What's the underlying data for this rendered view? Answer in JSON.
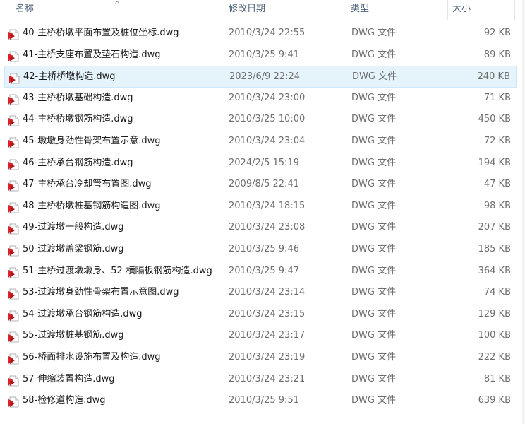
{
  "columns": {
    "name": "名称",
    "date": "修改日期",
    "type": "类型",
    "size": "大小"
  },
  "sort_indicator": "^",
  "icon": "dwg-file-icon",
  "colors": {
    "selected_bg": "#e5f3fb",
    "selected_border": "#cce8ff",
    "icon_red": "#d8232a"
  },
  "selected_index": 2,
  "files": [
    {
      "name": "40-主桥桥墩平面布置及桩位坐标.dwg",
      "date": "2010/3/24 22:55",
      "type": "DWG 文件",
      "size": "92 KB"
    },
    {
      "name": "41-主桥支座布置及垫石构造.dwg",
      "date": "2010/3/25 9:41",
      "type": "DWG 文件",
      "size": "89 KB"
    },
    {
      "name": "42-主桥桥墩构造.dwg",
      "date": "2023/6/9 22:24",
      "type": "DWG 文件",
      "size": "240 KB"
    },
    {
      "name": "43-主桥桥墩基础构造.dwg",
      "date": "2010/3/24 23:00",
      "type": "DWG 文件",
      "size": "71 KB"
    },
    {
      "name": "44-主桥桥墩钢筋构造.dwg",
      "date": "2010/3/25 10:00",
      "type": "DWG 文件",
      "size": "450 KB"
    },
    {
      "name": "45-墩墩身劲性骨架布置示意.dwg",
      "date": "2010/3/24 23:04",
      "type": "DWG 文件",
      "size": "72 KB"
    },
    {
      "name": "46-主桥承台钢筋构造.dwg",
      "date": "2024/2/5 15:19",
      "type": "DWG 文件",
      "size": "194 KB"
    },
    {
      "name": "47-主桥承台冷却管布置图.dwg",
      "date": "2009/8/5 22:41",
      "type": "DWG 文件",
      "size": "47 KB"
    },
    {
      "name": "48-主桥桥墩桩基钢筋构造图.dwg",
      "date": "2010/3/24 18:15",
      "type": "DWG 文件",
      "size": "98 KB"
    },
    {
      "name": "49-过渡墩一般构造.dwg",
      "date": "2010/3/24 23:08",
      "type": "DWG 文件",
      "size": "207 KB"
    },
    {
      "name": "50-过渡墩盖梁钢筋.dwg",
      "date": "2010/3/25 9:46",
      "type": "DWG 文件",
      "size": "185 KB"
    },
    {
      "name": "51-主桥过渡墩墩身、52-横隔板钢筋构造.dwg",
      "date": "2010/3/25 9:47",
      "type": "DWG 文件",
      "size": "364 KB"
    },
    {
      "name": "53-过渡墩身劲性骨架布置示意图.dwg",
      "date": "2010/3/24 23:14",
      "type": "DWG 文件",
      "size": "74 KB"
    },
    {
      "name": "54-过渡墩承台钢筋构造.dwg",
      "date": "2010/3/24 23:15",
      "type": "DWG 文件",
      "size": "129 KB"
    },
    {
      "name": "55-过渡墩桩基钢筋.dwg",
      "date": "2010/3/24 23:17",
      "type": "DWG 文件",
      "size": "100 KB"
    },
    {
      "name": "56-桥面排水设施布置及构造.dwg",
      "date": "2010/3/24 23:19",
      "type": "DWG 文件",
      "size": "222 KB"
    },
    {
      "name": "57-伸缩装置构造.dwg",
      "date": "2010/3/24 23:21",
      "type": "DWG 文件",
      "size": "81 KB"
    },
    {
      "name": "58-检修道构造.dwg",
      "date": "2010/3/25 9:51",
      "type": "DWG 文件",
      "size": "639 KB"
    }
  ]
}
